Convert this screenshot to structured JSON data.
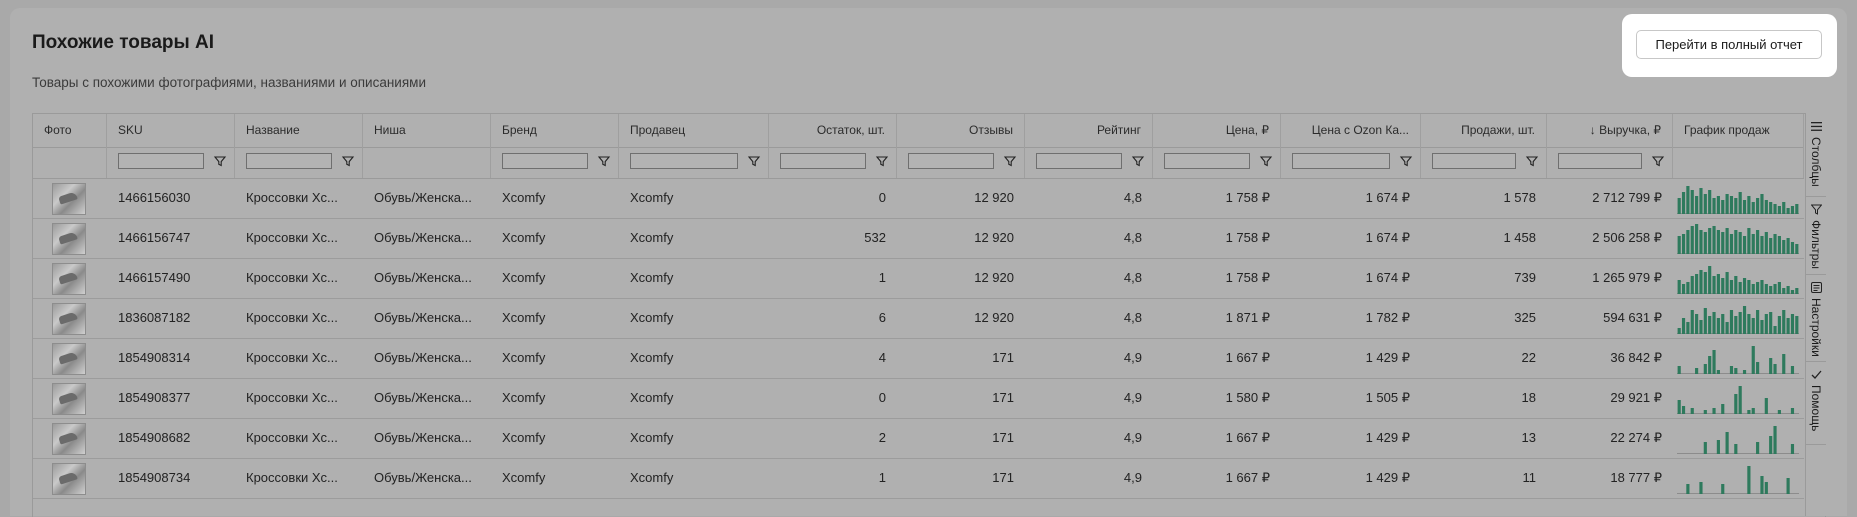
{
  "header": {
    "title": "Похожие товары AI",
    "subtitle": "Товары с похожими фотографиями, названиями и описаниями",
    "full_report_label": "Перейти в полный отчет"
  },
  "table": {
    "columns": [
      "Фото",
      "SKU",
      "Название",
      "Ниша",
      "Бренд",
      "Продавец",
      "Остаток, шт.",
      "Отзывы",
      "Рейтинг",
      "Цена, ₽",
      "Цена с Ozon Ка...",
      "Продажи, шт.",
      "↓ Выручка, ₽",
      "График продаж"
    ],
    "rows": [
      {
        "sku": "1466156030",
        "name": "Кроссовки Xc...",
        "niche": "Обувь/Женска...",
        "brand": "Xcomfy",
        "seller": "Xcomfy",
        "stock": "0",
        "reviews": "12 920",
        "rating": "4,8",
        "price": "1 758 ₽",
        "ozon_price": "1 674 ₽",
        "sales": "1 578",
        "revenue": "2 712 799 ₽",
        "chart": [
          8,
          11,
          14,
          12,
          9,
          13,
          10,
          12,
          8,
          9,
          7,
          10,
          9,
          8,
          11,
          7,
          9,
          6,
          8,
          10,
          7,
          6,
          5,
          4,
          6,
          3,
          4,
          5
        ]
      },
      {
        "sku": "1466156747",
        "name": "Кроссовки Xc...",
        "niche": "Обувь/Женска...",
        "brand": "Xcomfy",
        "seller": "Xcomfy",
        "stock": "532",
        "reviews": "12 920",
        "rating": "4,8",
        "price": "1 758 ₽",
        "ozon_price": "1 674 ₽",
        "sales": "1 458",
        "revenue": "2 506 258 ₽",
        "chart": [
          9,
          10,
          12,
          14,
          15,
          12,
          11,
          13,
          14,
          12,
          11,
          13,
          10,
          12,
          11,
          9,
          13,
          10,
          12,
          9,
          11,
          8,
          10,
          9,
          7,
          8,
          6,
          5
        ]
      },
      {
        "sku": "1466157490",
        "name": "Кроссовки Xc...",
        "niche": "Обувь/Женска...",
        "brand": "Xcomfy",
        "seller": "Xcomfy",
        "stock": "1",
        "reviews": "12 920",
        "rating": "4,8",
        "price": "1 758 ₽",
        "ozon_price": "1 674 ₽",
        "sales": "739",
        "revenue": "1 265 979 ₽",
        "chart": [
          7,
          5,
          6,
          9,
          10,
          12,
          11,
          14,
          9,
          10,
          8,
          11,
          7,
          9,
          6,
          8,
          7,
          5,
          6,
          7,
          5,
          4,
          5,
          6,
          3,
          4,
          2,
          3
        ]
      },
      {
        "sku": "1836087182",
        "name": "Кроссовки Xc...",
        "niche": "Обувь/Женска...",
        "brand": "Xcomfy",
        "seller": "Xcomfy",
        "stock": "6",
        "reviews": "12 920",
        "rating": "4,8",
        "price": "1 871 ₽",
        "ozon_price": "1 782 ₽",
        "sales": "325",
        "revenue": "594 631 ₽",
        "chart": [
          3,
          8,
          6,
          12,
          10,
          7,
          13,
          9,
          11,
          8,
          10,
          6,
          12,
          9,
          11,
          14,
          10,
          8,
          12,
          7,
          10,
          11,
          4,
          9,
          12,
          8,
          10,
          9
        ]
      },
      {
        "sku": "1854908314",
        "name": "Кроссовки Xc...",
        "niche": "Обувь/Женска...",
        "brand": "Xcomfy",
        "seller": "Xcomfy",
        "stock": "4",
        "reviews": "171",
        "rating": "4,9",
        "price": "1 667 ₽",
        "ozon_price": "1 429 ₽",
        "sales": "22",
        "revenue": "36 842 ₽",
        "chart": [
          4,
          0,
          0,
          0,
          3,
          0,
          5,
          9,
          12,
          2,
          0,
          0,
          4,
          3,
          0,
          2,
          0,
          14,
          6,
          0,
          0,
          8,
          5,
          0,
          10,
          0,
          4,
          0
        ]
      },
      {
        "sku": "1854908377",
        "name": "Кроссовки Xc...",
        "niche": "Обувь/Женска...",
        "brand": "Xcomfy",
        "seller": "Xcomfy",
        "stock": "0",
        "reviews": "171",
        "rating": "4,9",
        "price": "1 580 ₽",
        "ozon_price": "1 505 ₽",
        "sales": "18",
        "revenue": "29 921 ₽",
        "chart": [
          7,
          4,
          0,
          3,
          0,
          0,
          2,
          0,
          3,
          0,
          5,
          0,
          0,
          10,
          14,
          0,
          2,
          3,
          0,
          0,
          8,
          0,
          0,
          2,
          0,
          0,
          3,
          0
        ]
      },
      {
        "sku": "1854908682",
        "name": "Кроссовки Xc...",
        "niche": "Обувь/Женска...",
        "brand": "Xcomfy",
        "seller": "Xcomfy",
        "stock": "2",
        "reviews": "171",
        "rating": "4,9",
        "price": "1 667 ₽",
        "ozon_price": "1 429 ₽",
        "sales": "13",
        "revenue": "22 274 ₽",
        "chart": [
          0,
          0,
          0,
          0,
          0,
          0,
          6,
          0,
          0,
          7,
          0,
          11,
          0,
          5,
          0,
          0,
          0,
          0,
          6,
          0,
          0,
          9,
          14,
          0,
          0,
          0,
          5,
          0
        ]
      },
      {
        "sku": "1854908734",
        "name": "Кроссовки Xc...",
        "niche": "Обувь/Женска...",
        "brand": "Xcomfy",
        "seller": "Xcomfy",
        "stock": "1",
        "reviews": "171",
        "rating": "4,9",
        "price": "1 667 ₽",
        "ozon_price": "1 429 ₽",
        "sales": "11",
        "revenue": "18 777 ₽",
        "chart": [
          0,
          0,
          5,
          0,
          0,
          6,
          0,
          0,
          0,
          0,
          5,
          0,
          0,
          0,
          0,
          0,
          14,
          0,
          0,
          9,
          6,
          0,
          0,
          0,
          0,
          8,
          0,
          0
        ]
      }
    ]
  },
  "sidebar": {
    "columns_label": "Столбцы",
    "filters_label": "Фильтры",
    "settings_label": "Настройки",
    "help_label": "Помощь"
  },
  "colors": {
    "spark_bar": "#2e7a5d",
    "link": "#1f4f8a"
  },
  "icons": {
    "filter": "filter-icon",
    "columns": "columns-icon",
    "settings": "settings-icon",
    "help": "check-icon"
  }
}
